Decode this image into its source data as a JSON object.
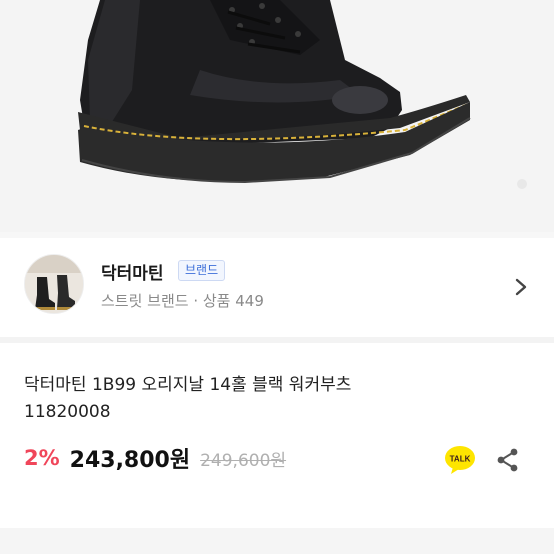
{
  "brand": {
    "name": "닥터마틴",
    "badge": "브랜드",
    "subtitle": "스트릿 브랜드 · 상품 449"
  },
  "product": {
    "title_line1": "닥터마틴 1B99 오리지날 14홀 블랙 워커부츠",
    "title_line2": "11820008",
    "discount": "2%",
    "price": "243,800원",
    "original_price": "249,600원"
  },
  "actions": {
    "talk_label": "TALK"
  },
  "colors": {
    "accent_discount": "#f0465a",
    "badge_text": "#3d6fd9",
    "talk_yellow": "#fee500"
  },
  "icons": {
    "chevron": "chevron-right-icon",
    "share": "share-icon",
    "talk": "kakao-talk-icon"
  }
}
